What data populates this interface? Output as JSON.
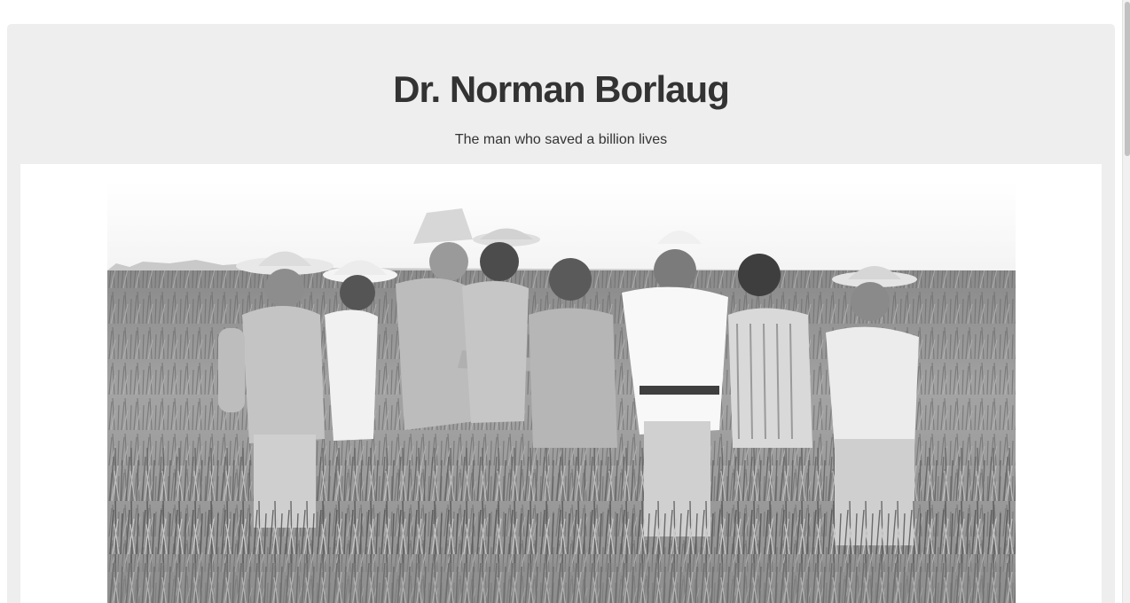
{
  "header": {
    "title": "Dr. Norman Borlaug",
    "subtitle": "The man who saved a billion lives"
  },
  "image": {
    "description": "Black and white photo of nine men standing in a wheat field"
  }
}
